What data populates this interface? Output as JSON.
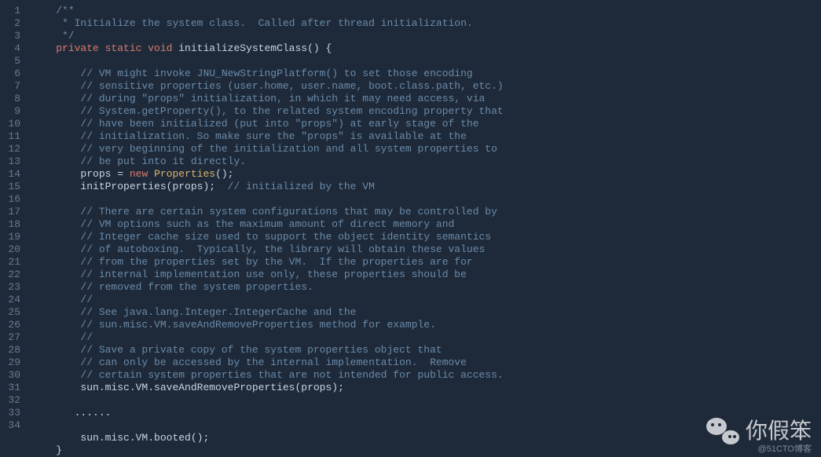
{
  "line_start": 1,
  "line_end": 34,
  "watermark_text": "你假笨",
  "attribution": "@51CTO博客",
  "code_lines": [
    {
      "tokens": [
        {
          "t": "    ",
          "c": ""
        },
        {
          "t": "/**",
          "c": "cm"
        }
      ]
    },
    {
      "tokens": [
        {
          "t": "     ",
          "c": ""
        },
        {
          "t": "* Initialize the system class.  Called after thread initialization.",
          "c": "cm"
        }
      ]
    },
    {
      "tokens": [
        {
          "t": "     ",
          "c": ""
        },
        {
          "t": "*/",
          "c": "cm"
        }
      ]
    },
    {
      "tokens": [
        {
          "t": "    ",
          "c": ""
        },
        {
          "t": "private static void ",
          "c": "kw"
        },
        {
          "t": "initializeSystemClass",
          "c": "fn"
        },
        {
          "t": "() {",
          "c": "op"
        }
      ]
    },
    {
      "tokens": [
        {
          "t": "",
          "c": ""
        }
      ]
    },
    {
      "tokens": [
        {
          "t": "        ",
          "c": ""
        },
        {
          "t": "// VM might invoke JNU_NewStringPlatform() to set those encoding",
          "c": "cm"
        }
      ]
    },
    {
      "tokens": [
        {
          "t": "        ",
          "c": ""
        },
        {
          "t": "// sensitive properties (user.home, user.name, boot.class.path, etc.)",
          "c": "cm"
        }
      ]
    },
    {
      "tokens": [
        {
          "t": "        ",
          "c": ""
        },
        {
          "t": "// during \"props\" initialization, in which it may need access, via",
          "c": "cm"
        }
      ]
    },
    {
      "tokens": [
        {
          "t": "        ",
          "c": ""
        },
        {
          "t": "// System.getProperty(), to the related system encoding property that",
          "c": "cm"
        }
      ]
    },
    {
      "tokens": [
        {
          "t": "        ",
          "c": ""
        },
        {
          "t": "// have been initialized (put into \"props\") at early stage of the",
          "c": "cm"
        }
      ]
    },
    {
      "tokens": [
        {
          "t": "        ",
          "c": ""
        },
        {
          "t": "// initialization. So make sure the \"props\" is available at the",
          "c": "cm"
        }
      ]
    },
    {
      "tokens": [
        {
          "t": "        ",
          "c": ""
        },
        {
          "t": "// very beginning of the initialization and all system properties to",
          "c": "cm"
        }
      ]
    },
    {
      "tokens": [
        {
          "t": "        ",
          "c": ""
        },
        {
          "t": "// be put into it directly.",
          "c": "cm"
        }
      ]
    },
    {
      "tokens": [
        {
          "t": "        ",
          "c": ""
        },
        {
          "t": "props = ",
          "c": "id"
        },
        {
          "t": "new ",
          "c": "kw"
        },
        {
          "t": "Properties",
          "c": "ty"
        },
        {
          "t": "();",
          "c": "op"
        }
      ]
    },
    {
      "tokens": [
        {
          "t": "        ",
          "c": ""
        },
        {
          "t": "initProperties(props);  ",
          "c": "id"
        },
        {
          "t": "// initialized by the VM",
          "c": "cm"
        }
      ]
    },
    {
      "tokens": [
        {
          "t": "",
          "c": ""
        }
      ]
    },
    {
      "tokens": [
        {
          "t": "        ",
          "c": ""
        },
        {
          "t": "// There are certain system configurations that may be controlled by",
          "c": "cm"
        }
      ]
    },
    {
      "tokens": [
        {
          "t": "        ",
          "c": ""
        },
        {
          "t": "// VM options such as the maximum amount of direct memory and",
          "c": "cm"
        }
      ]
    },
    {
      "tokens": [
        {
          "t": "        ",
          "c": ""
        },
        {
          "t": "// Integer cache size used to support the object identity semantics",
          "c": "cm"
        }
      ]
    },
    {
      "tokens": [
        {
          "t": "        ",
          "c": ""
        },
        {
          "t": "// of autoboxing.  Typically, the library will obtain these values",
          "c": "cm"
        }
      ]
    },
    {
      "tokens": [
        {
          "t": "        ",
          "c": ""
        },
        {
          "t": "// from the properties set by the VM.  If the properties are for",
          "c": "cm"
        }
      ]
    },
    {
      "tokens": [
        {
          "t": "        ",
          "c": ""
        },
        {
          "t": "// internal implementation use only, these properties should be",
          "c": "cm"
        }
      ]
    },
    {
      "tokens": [
        {
          "t": "        ",
          "c": ""
        },
        {
          "t": "// removed from the system properties.",
          "c": "cm"
        }
      ]
    },
    {
      "tokens": [
        {
          "t": "        ",
          "c": ""
        },
        {
          "t": "//",
          "c": "cm"
        }
      ]
    },
    {
      "tokens": [
        {
          "t": "        ",
          "c": ""
        },
        {
          "t": "// See java.lang.Integer.IntegerCache and the",
          "c": "cm"
        }
      ]
    },
    {
      "tokens": [
        {
          "t": "        ",
          "c": ""
        },
        {
          "t": "// sun.misc.VM.saveAndRemoveProperties method for example.",
          "c": "cm"
        }
      ]
    },
    {
      "tokens": [
        {
          "t": "        ",
          "c": ""
        },
        {
          "t": "//",
          "c": "cm"
        }
      ]
    },
    {
      "tokens": [
        {
          "t": "        ",
          "c": ""
        },
        {
          "t": "// Save a private copy of the system properties object that",
          "c": "cm"
        }
      ]
    },
    {
      "tokens": [
        {
          "t": "        ",
          "c": ""
        },
        {
          "t": "// can only be accessed by the internal implementation.  Remove",
          "c": "cm"
        }
      ]
    },
    {
      "tokens": [
        {
          "t": "        ",
          "c": ""
        },
        {
          "t": "// certain system properties that are not intended for public access.",
          "c": "cm"
        }
      ]
    },
    {
      "tokens": [
        {
          "t": "        ",
          "c": ""
        },
        {
          "t": "sun.misc.VM.saveAndRemoveProperties(props);",
          "c": "id"
        }
      ]
    },
    {
      "tokens": [
        {
          "t": "",
          "c": ""
        }
      ]
    },
    {
      "tokens": [
        {
          "t": "       ",
          "c": ""
        },
        {
          "t": "......",
          "c": "id"
        }
      ]
    },
    {
      "tokens": [
        {
          "t": "",
          "c": ""
        }
      ]
    },
    {
      "tokens": [
        {
          "t": "        ",
          "c": ""
        },
        {
          "t": "sun.misc.VM.booted();",
          "c": "id"
        }
      ]
    },
    {
      "tokens": [
        {
          "t": "    ",
          "c": ""
        },
        {
          "t": "}",
          "c": "op"
        }
      ]
    }
  ]
}
